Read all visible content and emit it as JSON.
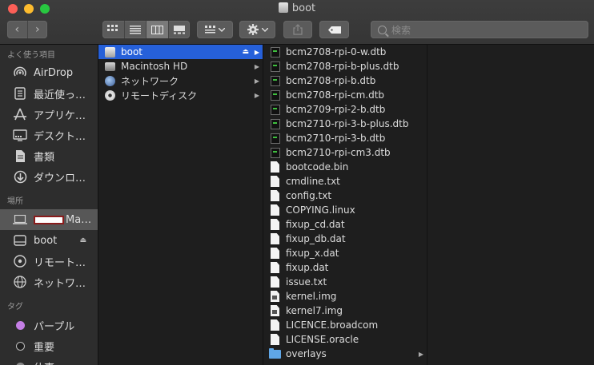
{
  "window": {
    "title": "boot"
  },
  "toolbar": {
    "back": "‹",
    "forward": "›",
    "search_placeholder": "検索"
  },
  "sidebar": {
    "favorites_header": "よく使う項目",
    "favorites": [
      {
        "label": "AirDrop",
        "icon": "airdrop-icon"
      },
      {
        "label": "最近使っ…",
        "icon": "recents-icon"
      },
      {
        "label": "アプリケ…",
        "icon": "applications-icon"
      },
      {
        "label": "デスクト…",
        "icon": "desktop-icon"
      },
      {
        "label": "書類",
        "icon": "documents-icon"
      },
      {
        "label": "ダウンロ…",
        "icon": "downloads-icon"
      }
    ],
    "locations_header": "場所",
    "locations": [
      {
        "label": "Ma…",
        "icon": "laptop-icon",
        "redacted": true
      },
      {
        "label": "boot",
        "icon": "disk-icon",
        "eject": true
      },
      {
        "label": "リモート…",
        "icon": "remote-disc-icon"
      },
      {
        "label": "ネットワ…",
        "icon": "network-icon"
      }
    ],
    "tags_header": "タグ",
    "tags": [
      {
        "label": "パープル",
        "color": "#c47ee5"
      },
      {
        "label": "重要",
        "color": "#1e1e1e"
      },
      {
        "label": "仕事",
        "color": "#888888"
      }
    ]
  },
  "column1": [
    {
      "label": "boot",
      "icon": "disk-icon",
      "selected": true,
      "eject": true
    },
    {
      "label": "Macintosh HD",
      "icon": "hard-drive-icon"
    },
    {
      "label": "ネットワーク",
      "icon": "network-icon"
    },
    {
      "label": "リモートディスク",
      "icon": "remote-disc-icon"
    }
  ],
  "column2": [
    {
      "label": "bcm2708-rpi-0-w.dtb",
      "type": "dtb"
    },
    {
      "label": "bcm2708-rpi-b-plus.dtb",
      "type": "dtb"
    },
    {
      "label": "bcm2708-rpi-b.dtb",
      "type": "dtb"
    },
    {
      "label": "bcm2708-rpi-cm.dtb",
      "type": "dtb"
    },
    {
      "label": "bcm2709-rpi-2-b.dtb",
      "type": "dtb"
    },
    {
      "label": "bcm2710-rpi-3-b-plus.dtb",
      "type": "dtb"
    },
    {
      "label": "bcm2710-rpi-3-b.dtb",
      "type": "dtb"
    },
    {
      "label": "bcm2710-rpi-cm3.dtb",
      "type": "dtb"
    },
    {
      "label": "bootcode.bin",
      "type": "doc"
    },
    {
      "label": "cmdline.txt",
      "type": "doc"
    },
    {
      "label": "config.txt",
      "type": "doc"
    },
    {
      "label": "COPYING.linux",
      "type": "doc"
    },
    {
      "label": "fixup_cd.dat",
      "type": "doc"
    },
    {
      "label": "fixup_db.dat",
      "type": "doc"
    },
    {
      "label": "fixup_x.dat",
      "type": "doc"
    },
    {
      "label": "fixup.dat",
      "type": "doc"
    },
    {
      "label": "issue.txt",
      "type": "doc"
    },
    {
      "label": "kernel.img",
      "type": "exec"
    },
    {
      "label": "kernel7.img",
      "type": "exec"
    },
    {
      "label": "LICENCE.broadcom",
      "type": "doc"
    },
    {
      "label": "LICENSE.oracle",
      "type": "doc"
    },
    {
      "label": "overlays",
      "type": "folder"
    }
  ]
}
